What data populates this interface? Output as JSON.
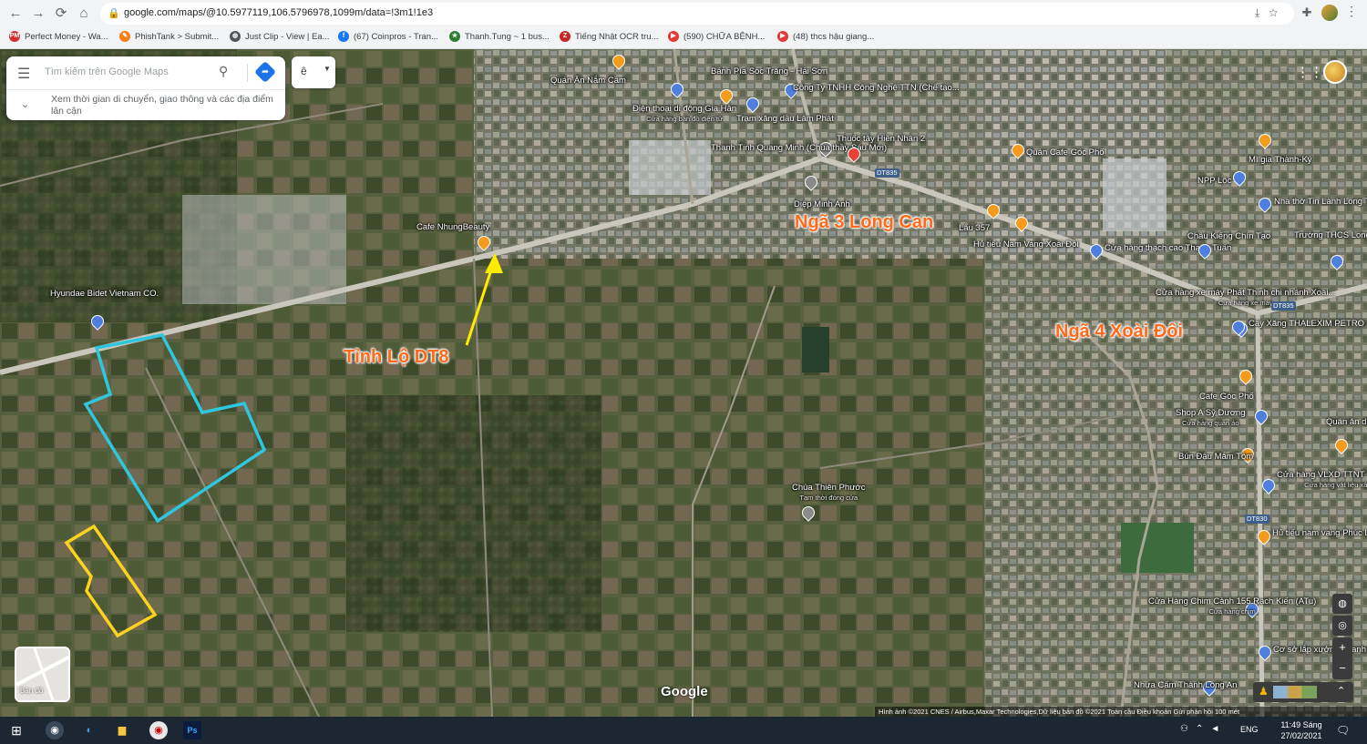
{
  "browser": {
    "url": "google.com/maps/@10.5977119,106.5796978,1099m/data=!3m1!1e3",
    "bookmarks": [
      {
        "label": "Perfect Money - Wa...",
        "color": "#d32f2f",
        "icon": "pm-icon",
        "glyph": "PM"
      },
      {
        "label": "PhishTank > Submit...",
        "color": "#f57f17",
        "icon": "phishtank-icon",
        "glyph": "✎"
      },
      {
        "label": "Just Clip - View | Ea...",
        "color": "#555555",
        "icon": "globe-icon",
        "glyph": "◍"
      },
      {
        "label": "(67) Coinpros - Tran...",
        "color": "#1877f2",
        "icon": "facebook-icon",
        "glyph": "f"
      },
      {
        "label": "Thanh.Tung ~ 1 bus...",
        "color": "#2e7d32",
        "icon": "star-icon",
        "glyph": "★"
      },
      {
        "label": "Tiếng Nhật OCR tru...",
        "color": "#c62828",
        "icon": "ocr-icon",
        "glyph": "Z"
      },
      {
        "label": "(590) CHỮA BỆNH...",
        "color": "#e53935",
        "icon": "youtube-icon",
        "glyph": "▶"
      },
      {
        "label": "(48) thcs hậu giang...",
        "color": "#e53935",
        "icon": "youtube-icon",
        "glyph": "▶"
      }
    ]
  },
  "search": {
    "placeholder": "Tìm kiếm trên Google Maps",
    "hint": "Xem thời gian di chuyển, giao thông và các địa điểm lân cận",
    "lang_value": "ê"
  },
  "annotations": {
    "road_label": "Tỉnh Lộ DT8",
    "junction_1": "Ngã 3 Long Can",
    "junction_2": "Ngã 4 Xoài Đôi"
  },
  "places": [
    {
      "name": "Quán Ăn Nắm Cầm",
      "sub": "",
      "pin": "orange"
    },
    {
      "name": "Bánh Pía Sóc Trăng - Hải Sơn",
      "sub": "",
      "pin": "orange"
    },
    {
      "name": "Công Ty TNHH Công Nghệ TTN (Chế tạo...",
      "sub": "",
      "pin": "blue"
    },
    {
      "name": "Điện thoại di động Gia Hân",
      "sub": "Cửa hàng bán đồ điện tử",
      "pin": "blue"
    },
    {
      "name": "Trạm xăng dầu Lâm Phát",
      "sub": "",
      "pin": "blue"
    },
    {
      "name": "Thanh Tịnh Quang Minh (Chùa thầy Sáu Mới)",
      "sub": "",
      "pin": "gray"
    },
    {
      "name": "Thuốc tây Hiền Nhân 2",
      "sub": "",
      "pin": "red"
    },
    {
      "name": "Quán Cafe Góc Phố",
      "sub": "",
      "pin": "orange"
    },
    {
      "name": "Mì gia Thành-Ký",
      "sub": "",
      "pin": "orange"
    },
    {
      "name": "NPP Lộc",
      "sub": "",
      "pin": "blue"
    },
    {
      "name": "Nhà thờ Tin Lành Long Trạch",
      "sub": "",
      "pin": "blue"
    },
    {
      "name": "Diệp Minh Anh",
      "sub": "",
      "pin": "gray"
    },
    {
      "name": "Cafe NhungBeauty",
      "sub": "",
      "pin": "orange"
    },
    {
      "name": "Hủ tiếu Nam Vang Xoài Đôi",
      "sub": "",
      "pin": "orange"
    },
    {
      "name": "Lẩu 357",
      "sub": "",
      "pin": "orange"
    },
    {
      "name": "Cửa hàng thạch cao Thanh Tuấn",
      "sub": "",
      "pin": "blue"
    },
    {
      "name": "Châu Kiếng Chín Tạo",
      "sub": "",
      "pin": "blue"
    },
    {
      "name": "Trường THCS Long Trạch",
      "sub": "",
      "pin": "blue"
    },
    {
      "name": "Hyundae Bidet Vietnam CO.",
      "sub": "",
      "pin": "blue"
    },
    {
      "name": "Cửa hàng xe máy Phát Thịnh chi nhánh Xoài...",
      "sub": "Cửa hàng xe máy",
      "pin": "blue"
    },
    {
      "name": "Cây Xăng THALEXIM PETRO - cn Huỳnh...",
      "sub": "",
      "pin": "blue"
    },
    {
      "name": "Cafe Góc Phố",
      "sub": "",
      "pin": "orange"
    },
    {
      "name": "Shop A Sỹ Dương",
      "sub": "Cửa hàng quần áo",
      "pin": "blue"
    },
    {
      "name": "Quán ăn dinh Sơn",
      "sub": "",
      "pin": "orange"
    },
    {
      "name": "Bún Đậu Mắm Tôm",
      "sub": "",
      "pin": "orange"
    },
    {
      "name": "Cửa hàng VLXD TTNT TOÀN PHÁT",
      "sub": "Cửa hàng vật liệu xây dựng",
      "pin": "blue"
    },
    {
      "name": "Chùa Thiên Phước",
      "sub": "Tạm thời đóng cửa",
      "pin": "gray"
    },
    {
      "name": "Hủ tiếu nam vang Phúc Lâm",
      "sub": "",
      "pin": "orange"
    },
    {
      "name": "Cửa Hàng Chim Cảnh 155 Rạch Kiến (ATu)",
      "sub": "Cửa hàng chim",
      "pin": "blue"
    },
    {
      "name": "Cơ sở lắp xưởng Thanh Tuyền",
      "sub": "",
      "pin": "blue"
    },
    {
      "name": "Nhựa Cẩm Thành Long An",
      "sub": "",
      "pin": "blue"
    }
  ],
  "road_tags": [
    "DT835",
    "DT835",
    "DT830"
  ],
  "map_ui": {
    "layers_label": "Bản đồ",
    "google": "Google",
    "attribution": "Hình ảnh ©2021 CNES / Airbus,Maxar Technologies,Dữ liệu bản đồ ©2021   Toàn cầu   Điều khoản   Gửi phản hồi   100 mét"
  },
  "taskbar": {
    "time": "11:49 Sáng",
    "date": "27/02/2021",
    "lang": "ENG"
  },
  "colors": {
    "plot_cyan": "#2fc6e0",
    "plot_yellow": "#ffd21f",
    "arrow_yellow": "#ffea00",
    "label_orange": "#ff6a1a"
  }
}
